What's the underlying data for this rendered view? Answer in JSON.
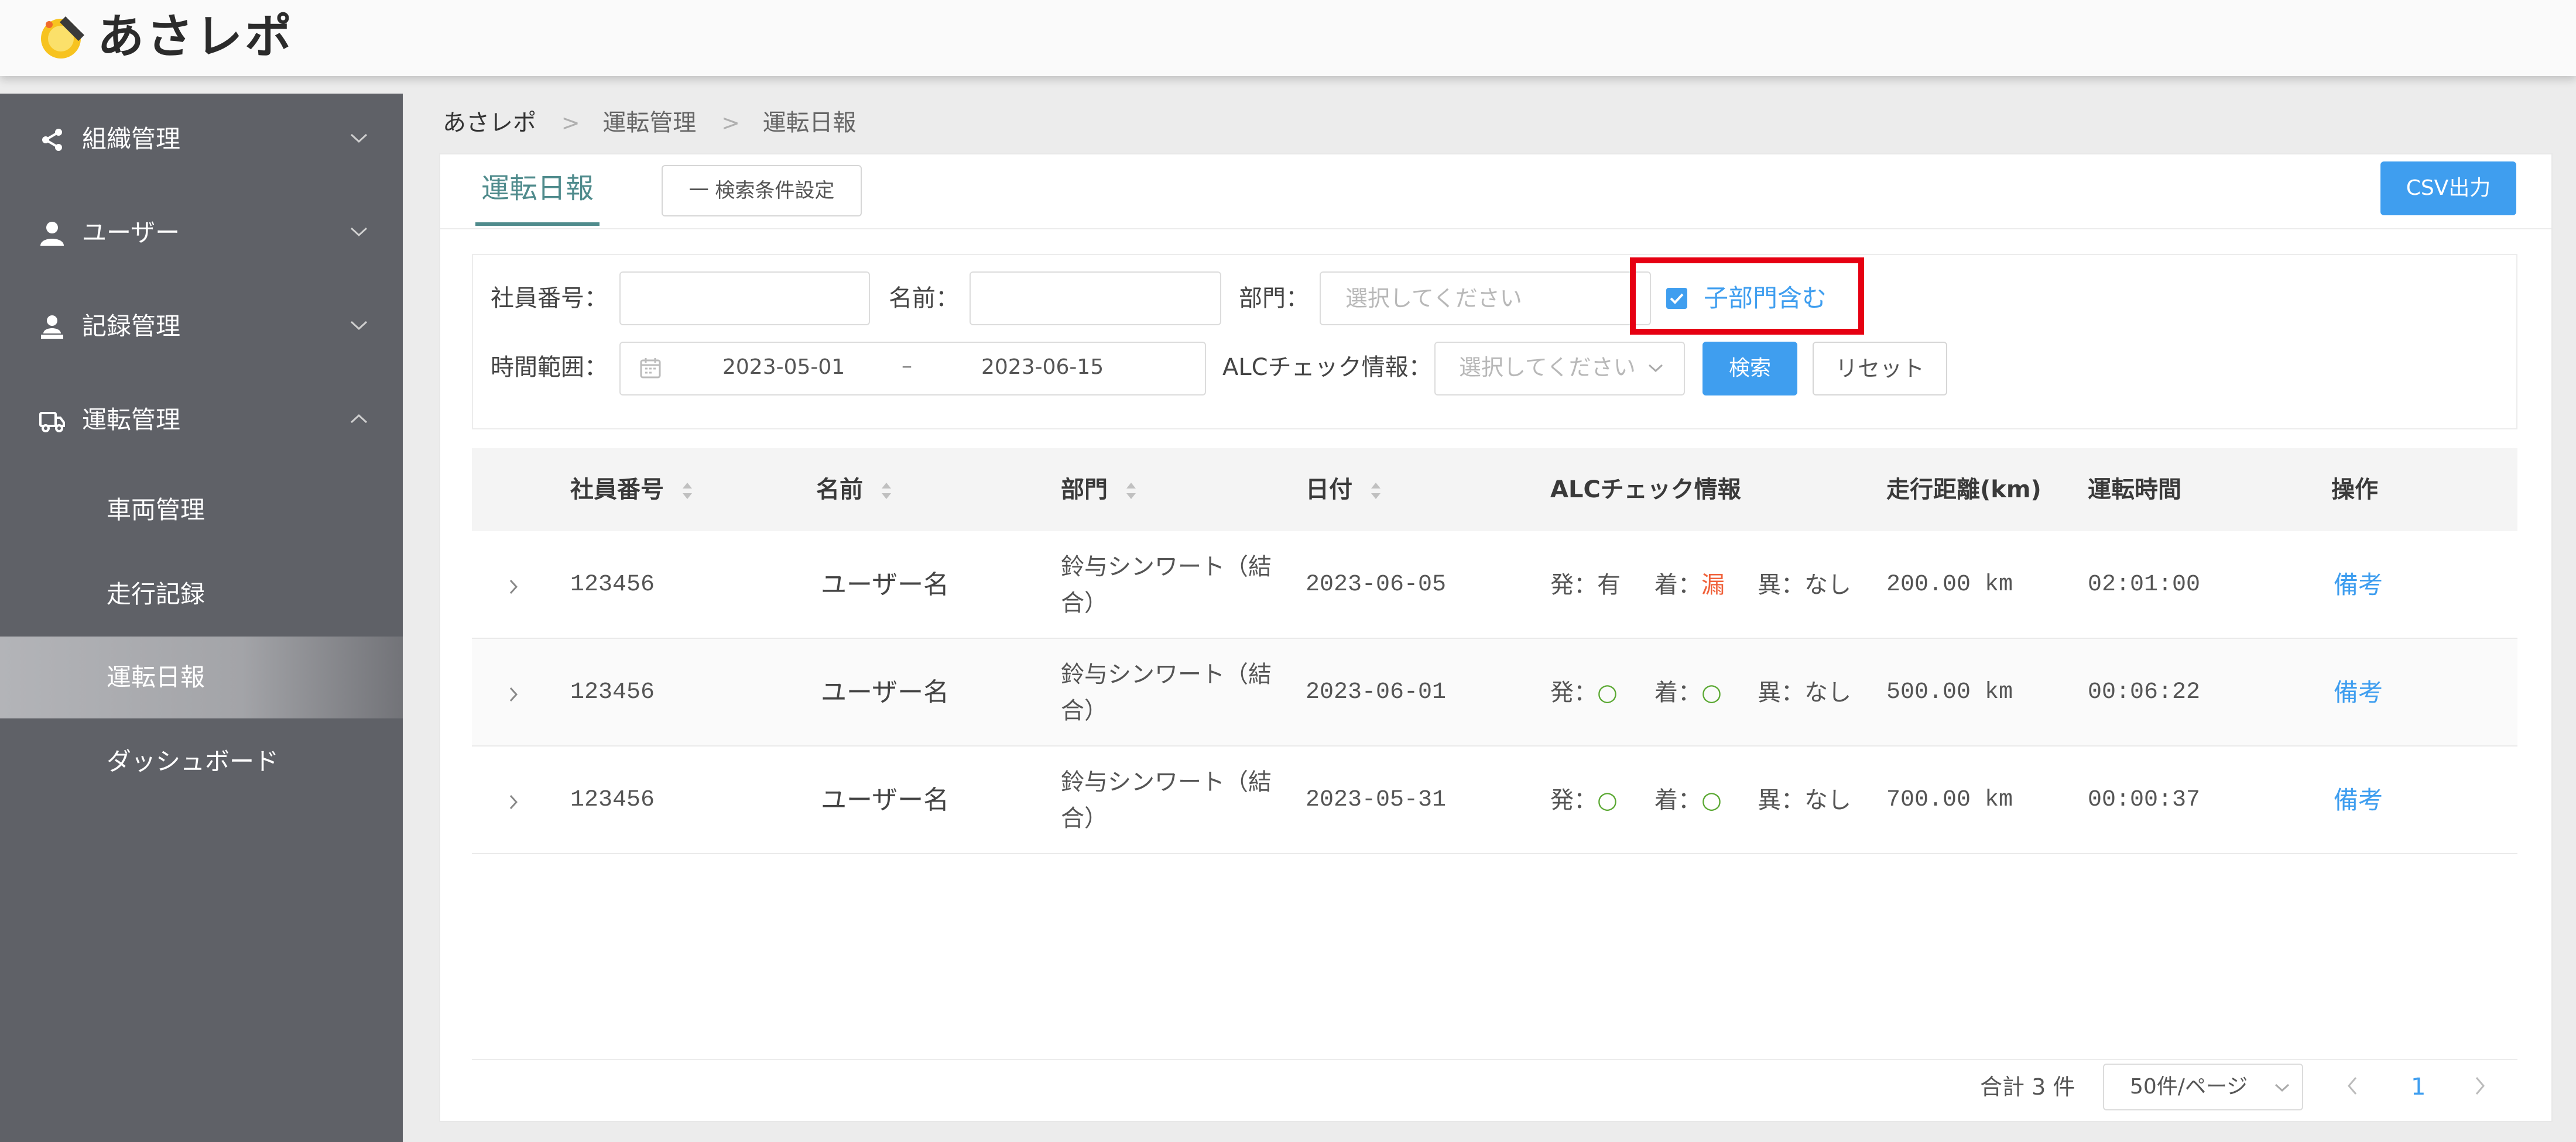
{
  "app": {
    "title": "あさレポ"
  },
  "sidebar": {
    "groups": [
      {
        "label": "組織管理",
        "icon": "share-icon"
      },
      {
        "label": "ユーザー",
        "icon": "user-icon"
      },
      {
        "label": "記録管理",
        "icon": "record-icon"
      },
      {
        "label": "運転管理",
        "icon": "truck-icon",
        "expanded": true
      }
    ],
    "subitems": [
      {
        "label": "車両管理"
      },
      {
        "label": "走行記録"
      },
      {
        "label": "運転日報",
        "active": true
      },
      {
        "label": "ダッシュボード"
      }
    ]
  },
  "breadcrumb": [
    "あさレポ",
    "運転管理",
    "運転日報"
  ],
  "page": {
    "tab_title": "運転日報",
    "condition_button": "一 検索条件設定",
    "csv_button": "CSV出力"
  },
  "search": {
    "employee_no_label": "社員番号：",
    "employee_no_value": "",
    "name_label": "名前：",
    "name_value": "",
    "dept_label": "部門：",
    "dept_placeholder": "選択してください",
    "include_subdept_label": "子部門含む",
    "include_subdept_checked": true,
    "time_range_label": "時間範囲：",
    "date_from": "2023-05-01",
    "date_sep": "–",
    "date_to": "2023-06-15",
    "alc_label": "ALCチェック情報：",
    "alc_placeholder": "選択してください",
    "search_button": "検索",
    "reset_button": "リセット"
  },
  "table": {
    "columns": [
      "社員番号",
      "名前",
      "部門",
      "日付",
      "ALCチェック情報",
      "走行距離(km)",
      "運転時間",
      "操作"
    ],
    "rows": [
      {
        "employee_no": "123456",
        "name": "ユーザー名",
        "dept_line1": "鈴与シンワート（結",
        "dept_line2": "合）",
        "date": "2023-06-05",
        "alc_dep_label": "発：",
        "alc_dep_value": "有",
        "alc_arr_label": "着：",
        "alc_arr_value": "漏",
        "alc_abn": "異：なし",
        "distance": "200.00 km",
        "drive_time": "02:01:00",
        "action": "備考"
      },
      {
        "employee_no": "123456",
        "name": "ユーザー名",
        "dept_line1": "鈴与シンワート（結",
        "dept_line2": "合）",
        "date": "2023-06-01",
        "alc_dep_label": "発：",
        "alc_dep_value": "○",
        "alc_arr_label": "着：",
        "alc_arr_value": "○",
        "alc_abn": "異：なし",
        "distance": "500.00 km",
        "drive_time": "00:06:22",
        "action": "備考"
      },
      {
        "employee_no": "123456",
        "name": "ユーザー名",
        "dept_line1": "鈴与シンワート（結",
        "dept_line2": "合）",
        "date": "2023-05-31",
        "alc_dep_label": "発：",
        "alc_dep_value": "○",
        "alc_arr_label": "着：",
        "alc_arr_value": "○",
        "alc_abn": "異：なし",
        "distance": "700.00 km",
        "drive_time": "00:00:37",
        "action": "備考"
      }
    ]
  },
  "pagination": {
    "total": "合計 3 件",
    "page_size": "50件/ページ",
    "current_page": "1"
  },
  "colors": {
    "accent": "#3f9eef",
    "tab_accent": "#4f8b8c",
    "sidebar_bg": "#5f6167",
    "highlight": "#e60012",
    "alc_missing": "#f0623b",
    "alc_ok": "#5aa832"
  }
}
